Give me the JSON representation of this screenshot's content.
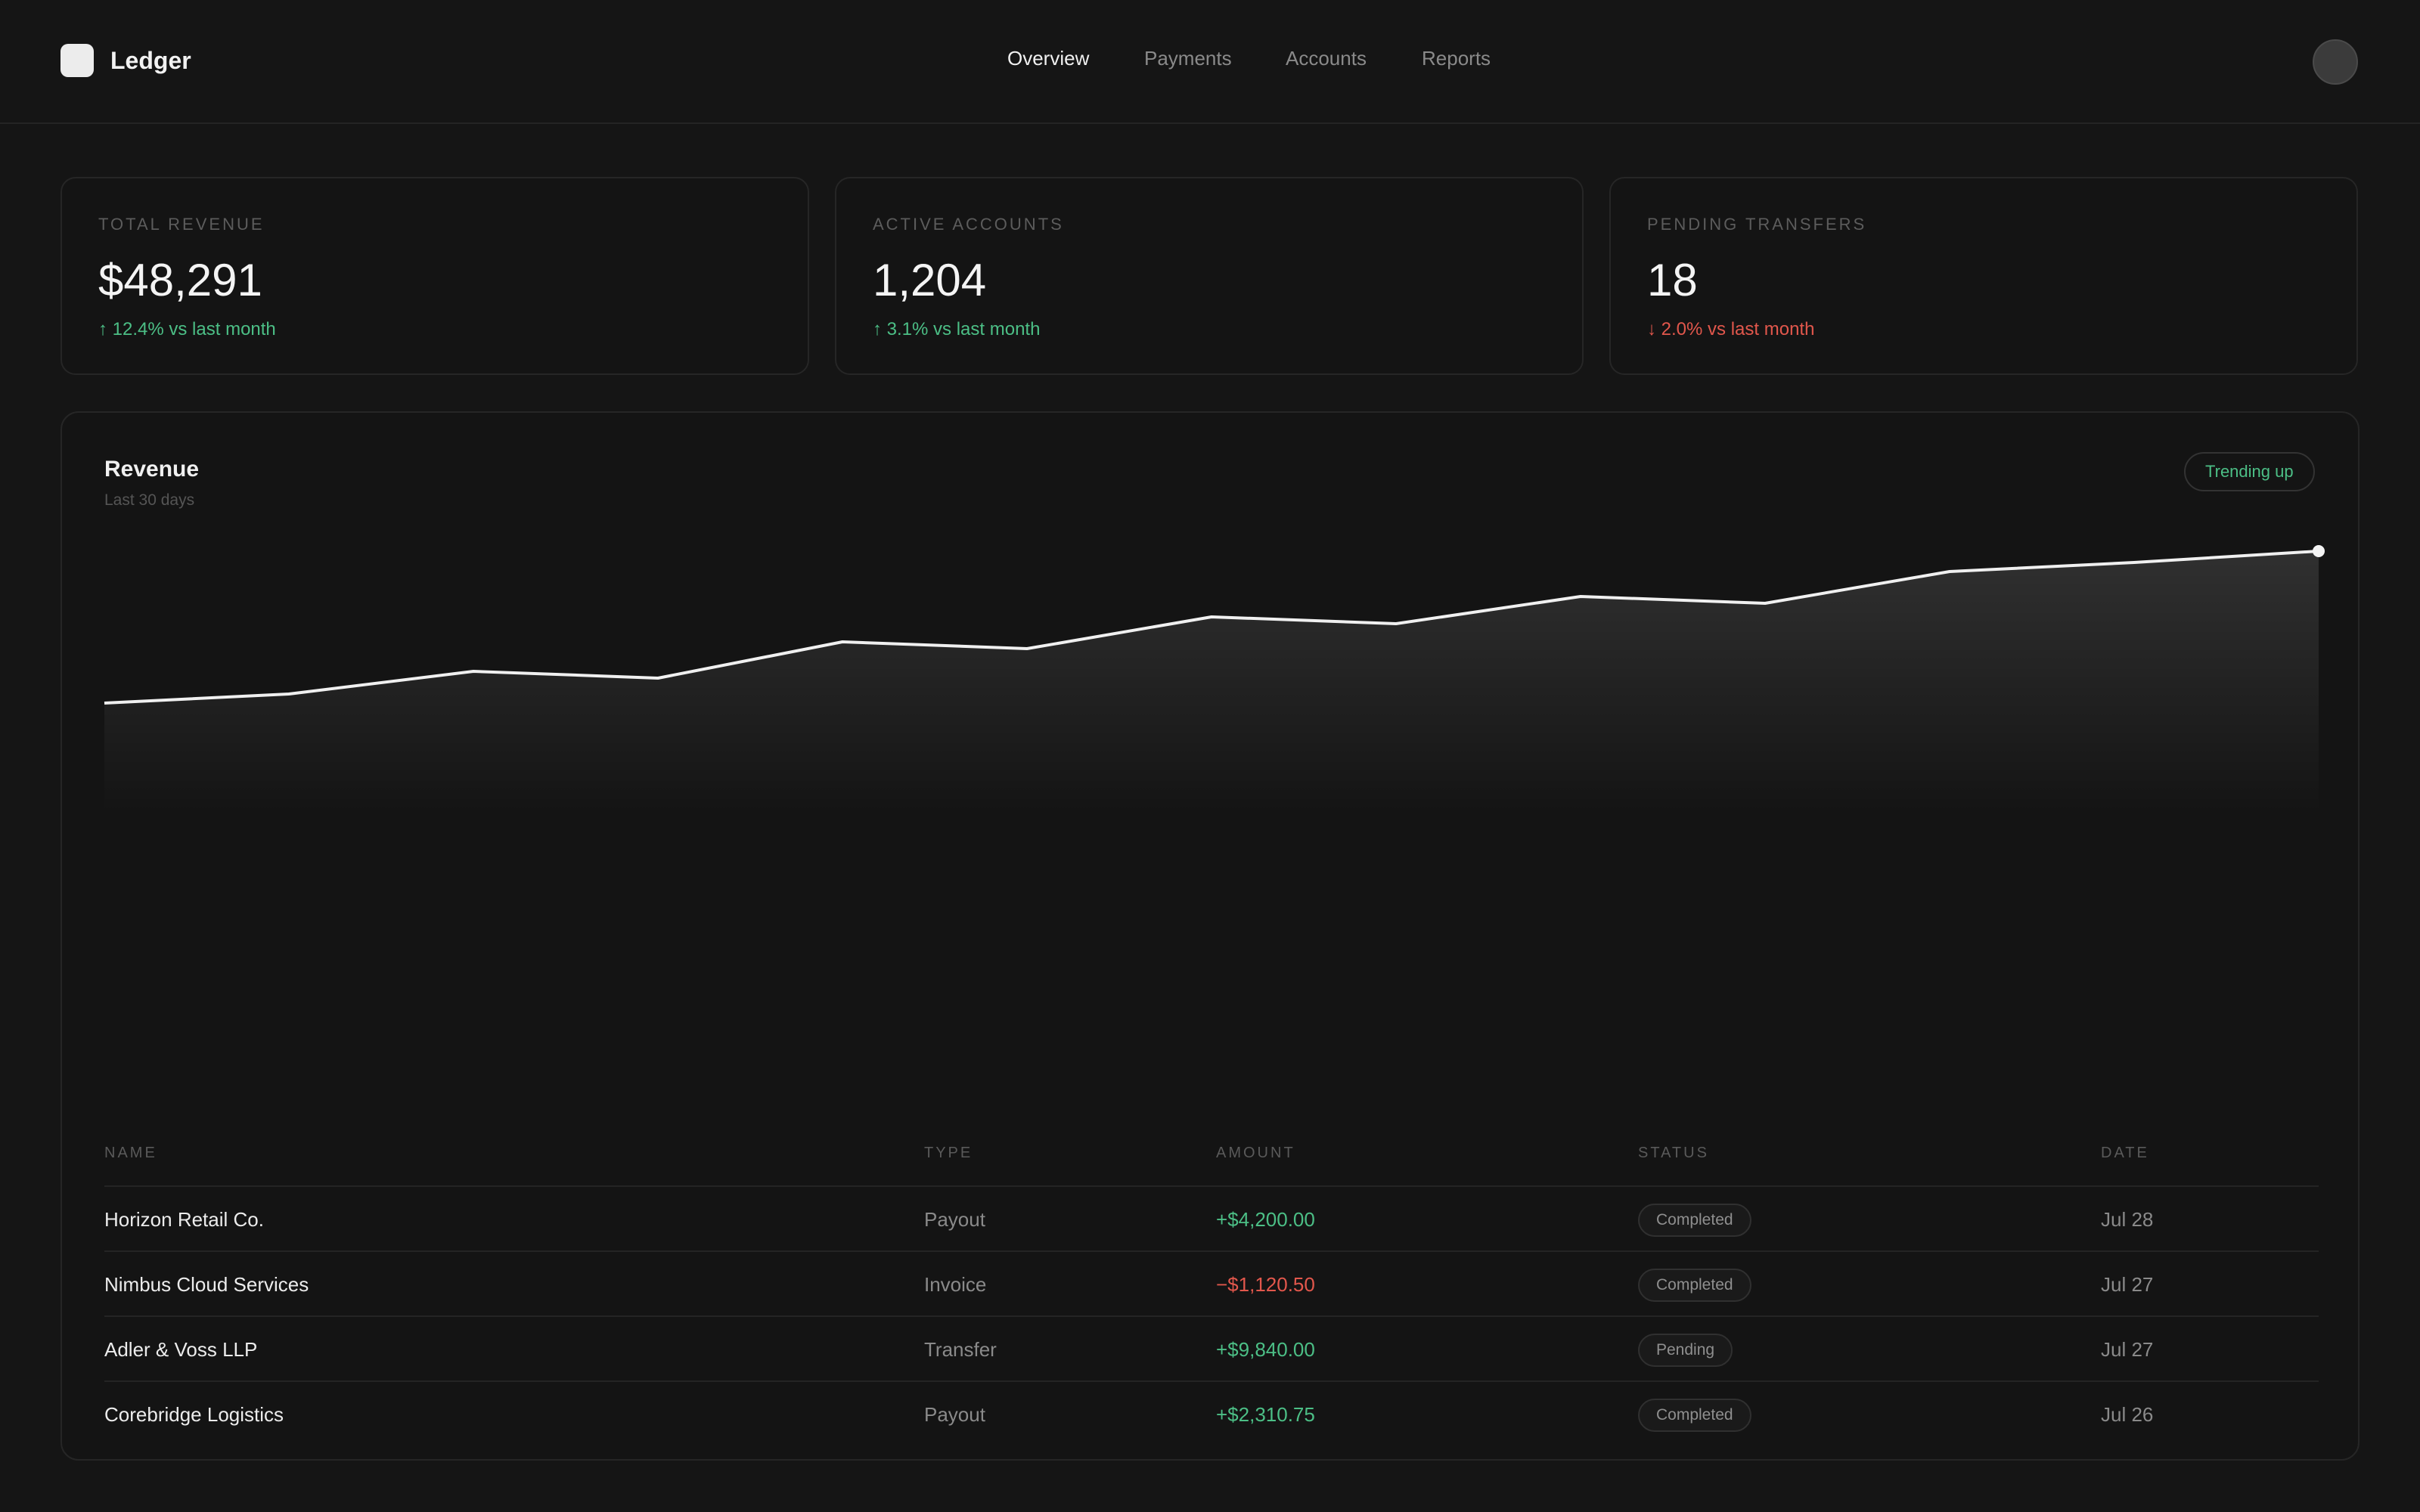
{
  "header": {
    "logo_icon": "app-logo-square",
    "brand": "Ledger",
    "nav": [
      {
        "label": "Overview",
        "active": true
      },
      {
        "label": "Payments",
        "active": false
      },
      {
        "label": "Accounts",
        "active": false
      },
      {
        "label": "Reports",
        "active": false
      }
    ]
  },
  "kpis": [
    {
      "label": "TOTAL REVENUE",
      "value": "$48,291",
      "delta": "↑ 12.4% vs last month",
      "direction": "up"
    },
    {
      "label": "ACTIVE ACCOUNTS",
      "value": "1,204",
      "delta": "↑ 3.1% vs last month",
      "direction": "up"
    },
    {
      "label": "PENDING TRANSFERS",
      "value": "18",
      "delta": "↓ 2.0% vs last month",
      "direction": "down"
    }
  ],
  "revenue": {
    "title": "Revenue",
    "subtitle": "Last 30 days",
    "badge": "Trending up"
  },
  "chart_data": {
    "type": "area",
    "series": [
      {
        "values": [
          24,
          26,
          31,
          29.5,
          37.5,
          36,
          43,
          41.5,
          47.5,
          46,
          53,
          55,
          57.5
        ]
      }
    ],
    "ylim": [
      0,
      100
    ],
    "grid": false
  },
  "table": {
    "headers": [
      "NAME",
      "TYPE",
      "AMOUNT",
      "STATUS",
      "DATE"
    ],
    "rows": [
      {
        "name": "Horizon Retail Co.",
        "type": "Payout",
        "amount": "+$4,200.00",
        "sign": "pos",
        "status": "Completed",
        "date": "Jul 28"
      },
      {
        "name": "Nimbus Cloud Services",
        "type": "Invoice",
        "amount": "−$1,120.50",
        "sign": "neg",
        "status": "Completed",
        "date": "Jul 27"
      },
      {
        "name": "Adler & Voss LLP",
        "type": "Transfer",
        "amount": "+$9,840.00",
        "sign": "pos",
        "status": "Pending",
        "date": "Jul 27"
      },
      {
        "name": "Corebridge Logistics",
        "type": "Payout",
        "amount": "+$2,310.75",
        "sign": "pos",
        "status": "Completed",
        "date": "Jul 26"
      }
    ]
  },
  "colors": {
    "positive": "#4cbf86",
    "negative": "#e2574c",
    "background": "#151515"
  }
}
